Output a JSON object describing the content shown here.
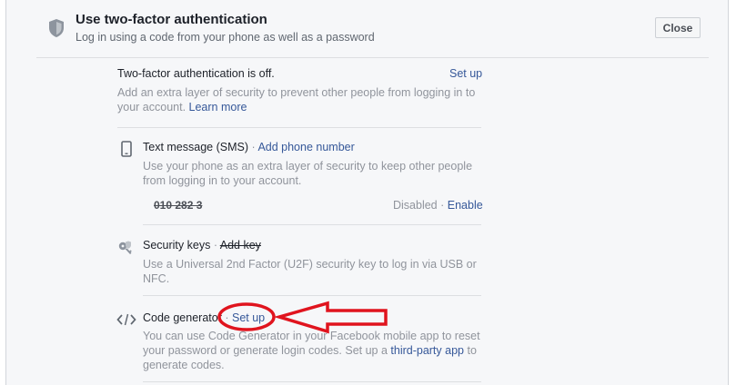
{
  "header": {
    "title": "Use two-factor authentication",
    "subtitle": "Log in using a code from your phone as well as a password",
    "close_label": "Close"
  },
  "status": {
    "text": "Two-factor authentication is off.",
    "setup_link": "Set up",
    "description": "Add an extra layer of security to prevent other people from logging in to your account.",
    "learn_more": "Learn more"
  },
  "sms": {
    "title": "Text message (SMS)",
    "separator": " · ",
    "add_link": "Add phone number",
    "description": "Use your phone as an extra layer of security to keep other people from logging in to your account.",
    "phone_number": "010 282 3",
    "state": "Disabled",
    "state_sep": " · ",
    "enable_link": "Enable"
  },
  "security_keys": {
    "title": "Security keys",
    "separator": " · ",
    "add_link": "Add key",
    "description": "Use a Universal 2nd Factor (U2F) security key to log in via USB or NFC."
  },
  "code_generator": {
    "title": "Code generator",
    "separator": " · ",
    "setup_link": "Set up",
    "desc_part1": "You can use Code Generator in your Facebook mobile app to reset your password or generate login codes. Set up a ",
    "third_party_link": "third-party app",
    "desc_part2": " to generate codes."
  },
  "annotation": {
    "color": "#e0141e"
  },
  "icons": {
    "header": "shield-icon",
    "sms": "phone-icon",
    "security_keys": "key-icon",
    "code_generator": "code-icon"
  }
}
